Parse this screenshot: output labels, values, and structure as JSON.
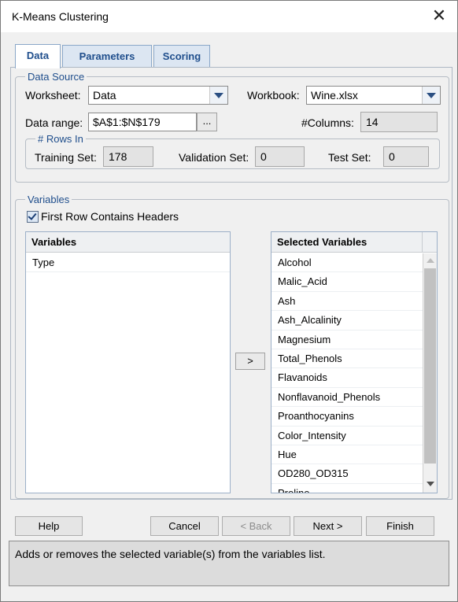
{
  "window": {
    "title": "K-Means Clustering",
    "close_icon": "close-icon"
  },
  "tabs": [
    {
      "label": "Data",
      "active": true
    },
    {
      "label": "Parameters",
      "active": false
    },
    {
      "label": "Scoring",
      "active": false
    }
  ],
  "data_source": {
    "legend": "Data Source",
    "worksheet_label": "Worksheet:",
    "worksheet_value": "Data",
    "workbook_label": "Workbook:",
    "workbook_value": "Wine.xlsx",
    "data_range_label": "Data range:",
    "data_range_value": "$A$1:$N$179",
    "browse_label": "...",
    "columns_label": "#Columns:",
    "columns_value": "14",
    "rows_in": {
      "legend": "# Rows In",
      "training_label": "Training Set:",
      "training_value": "178",
      "validation_label": "Validation Set:",
      "validation_value": "0",
      "test_label": "Test Set:",
      "test_value": "0"
    }
  },
  "variables": {
    "legend": "Variables",
    "first_row_headers_label": "First Row Contains Headers",
    "first_row_headers_checked": true,
    "available_header": "Variables",
    "available": [
      "Type"
    ],
    "move_button_label": ">",
    "selected_header": "Selected Variables",
    "selected": [
      "Alcohol",
      "Malic_Acid",
      "Ash",
      "Ash_Alcalinity",
      "Magnesium",
      "Total_Phenols",
      "Flavanoids",
      "Nonflavanoid_Phenols",
      "Proanthocyanins",
      "Color_Intensity",
      "Hue",
      "OD280_OD315",
      "Proline"
    ]
  },
  "footer": {
    "help": "Help",
    "cancel": "Cancel",
    "back": "< Back",
    "next": "Next >",
    "finish": "Finish"
  },
  "help_text": "Adds or removes the selected variable(s) from the variables list.",
  "colors": {
    "tab_text": "#1f4e8c",
    "legend_text": "#1f4e8c",
    "tab_bg": "#dce6f2"
  }
}
